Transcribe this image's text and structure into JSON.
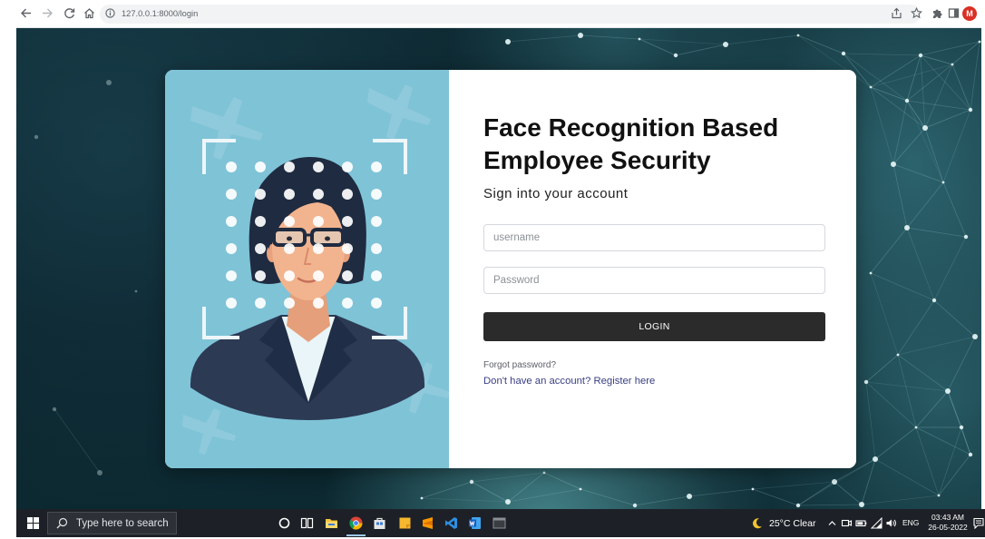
{
  "browser": {
    "url": "127.0.0.1:8000/login",
    "avatar_initial": "M",
    "toolbar_icons": [
      "back-arrow-icon",
      "forward-arrow-icon",
      "reload-icon",
      "home-icon",
      "site-info-icon",
      "share-icon",
      "bookmark-star-icon",
      "extensions-icon",
      "side-panel-icon"
    ]
  },
  "login": {
    "title_line_1": "Face Recognition Based",
    "title_line_2": "Employee Security",
    "subtitle": "Sign into your account",
    "username_placeholder": "username",
    "password_placeholder": "Password",
    "login_button": "LOGIN",
    "forgot_password": "Forgot password?",
    "register": "Don't have an account? Register here"
  },
  "taskbar": {
    "search_placeholder": "Type here to search",
    "pinned_apps": [
      "file-explorer-icon",
      "chrome-icon",
      "store-icon",
      "sticky-notes-icon",
      "sublime-text-icon",
      "vs-code-icon",
      "word-icon",
      "terminal-icon"
    ],
    "active_app": "chrome-icon",
    "weather": "25°C Clear",
    "language": "ENG",
    "time": "03:43 AM",
    "date": "26-05-2022"
  },
  "colors": {
    "illustration_panel": "#7fc3d7",
    "login_button": "#2b2b2b",
    "register_link": "#393f81",
    "avatar": "#d93025",
    "page_background": "#0e2a33",
    "taskbar": "#1d2127"
  }
}
